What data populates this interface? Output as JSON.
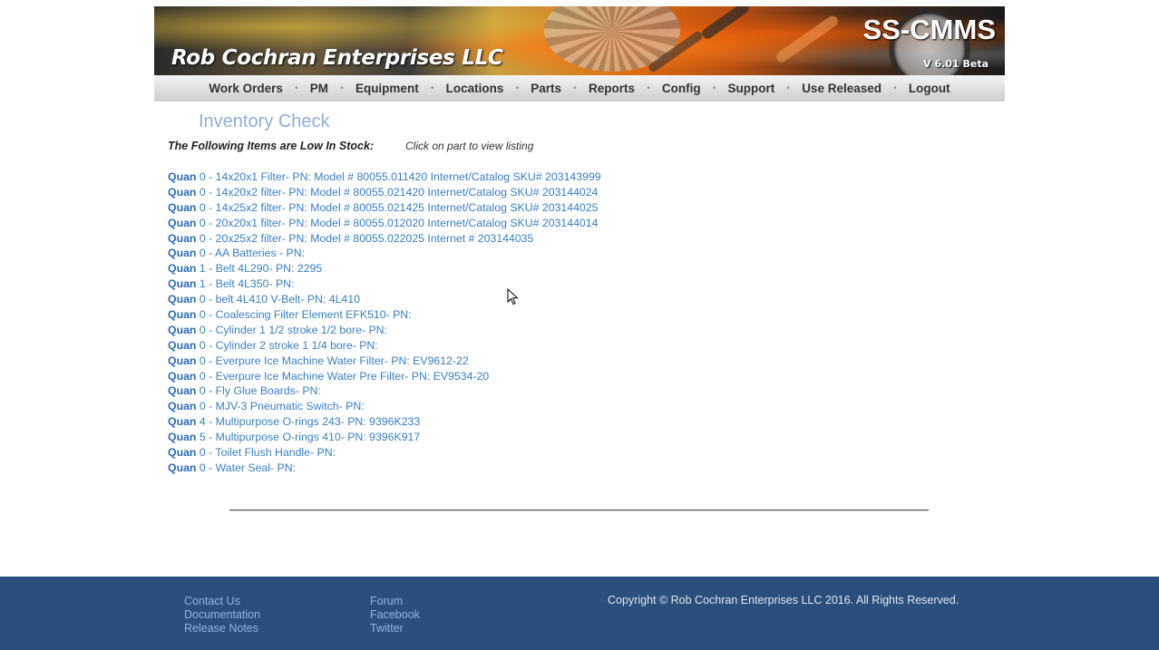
{
  "header": {
    "company_name": "Rob Cochran Enterprises LLC",
    "app_name": "SS-CMMS",
    "version": "V 6.01 Beta"
  },
  "nav": {
    "items": [
      "Work Orders",
      "PM",
      "Equipment",
      "Locations",
      "Parts",
      "Reports",
      "Config",
      "Support",
      "Use Released",
      "Logout"
    ]
  },
  "main": {
    "title": "Inventory Check",
    "low_stock_heading": "The Following Items are Low In Stock:",
    "hint": "Click on part to view listing",
    "quan_label": "Quan",
    "items": [
      {
        "qty": "0",
        "text": "14x20x1 Filter- PN: Model # 80055.011420 Internet/Catalog SKU# 203143999"
      },
      {
        "qty": "0",
        "text": "14x20x2 filter- PN: Model # 80055.021420 Internet/Catalog SKU# 203144024"
      },
      {
        "qty": "0",
        "text": "14x25x2 filter- PN: Model # 80055.021425 Internet/Catalog SKU# 203144025"
      },
      {
        "qty": "0",
        "text": "20x20x1 filter- PN: Model # 80055.012020 Internet/Catalog SKU# 203144014"
      },
      {
        "qty": "0",
        "text": "20x25x2 filter- PN: Model # 80055.022025 Internet # 203144035"
      },
      {
        "qty": "0",
        "text": "AA Batteries - PN:"
      },
      {
        "qty": "1",
        "text": "Belt 4L290- PN: 2295"
      },
      {
        "qty": "1",
        "text": "Belt 4L350- PN:"
      },
      {
        "qty": "0",
        "text": "belt 4L410 V-Belt- PN: 4L410"
      },
      {
        "qty": "0",
        "text": "Coalescing Filter Element EFK510- PN:"
      },
      {
        "qty": "0",
        "text": "Cylinder 1 1/2 stroke 1/2 bore- PN:"
      },
      {
        "qty": "0",
        "text": "Cylinder 2 stroke 1 1/4 bore- PN:"
      },
      {
        "qty": "0",
        "text": "Everpure Ice Machine Water Filter- PN: EV9612-22"
      },
      {
        "qty": "0",
        "text": "Everpure Ice Machine Water Pre Filter- PN: EV9534-20"
      },
      {
        "qty": "0",
        "text": "Fly Glue Boards- PN:"
      },
      {
        "qty": "0",
        "text": "MJV-3 Pneumatic Switch- PN:"
      },
      {
        "qty": "4",
        "text": "Multipurpose O-rings 243- PN: 9396K233"
      },
      {
        "qty": "5",
        "text": "Multipurpose O-rings 410- PN: 9396K917"
      },
      {
        "qty": "0",
        "text": "Toilet Flush Handle- PN:"
      },
      {
        "qty": "0",
        "text": "Water Seal- PN:"
      }
    ]
  },
  "footer": {
    "col1": [
      "Contact Us",
      "Documentation",
      "Release Notes"
    ],
    "col2": [
      "Forum",
      "Facebook",
      "Twitter"
    ],
    "copyright": "Copyright © Rob Cochran Enterprises LLC 2016. All Rights Reserved."
  },
  "colors": {
    "link": "#3a7fc0",
    "title": "#8fb0d6",
    "footer_bg": "#2b4f7c",
    "footer_link": "#8fb4e0"
  }
}
